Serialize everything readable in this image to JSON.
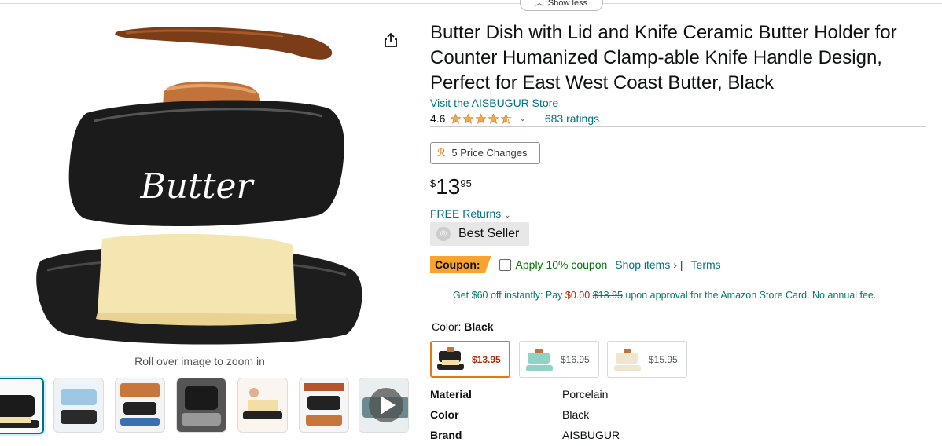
{
  "top": {
    "show_less": "Show less"
  },
  "gallery": {
    "zoom_hint": "Roll over image to zoom in",
    "logo_text": "Butter"
  },
  "product": {
    "title": "Butter Dish with Lid and Knife Ceramic Butter Holder for Counter Humanized Clamp-able Knife Handle Design, Perfect for East West Coast Butter, Black",
    "store_link": "Visit the AISBUGUR Store",
    "rating_value": "4.6",
    "rating_stars": 4.6,
    "ratings_count": "683 ratings",
    "price_changes": "5 Price Changes",
    "price_symbol": "$",
    "price_whole": "13",
    "price_fraction": "95",
    "free_returns": "FREE Returns",
    "best_seller": "Best Seller"
  },
  "coupon": {
    "tag": "Coupon:",
    "apply": "Apply 10% coupon",
    "shop_items": "Shop items ›",
    "separator": "|",
    "terms": "Terms"
  },
  "offer": {
    "part1": "Get $60 off instantly: Pay ",
    "pay_amount": "$0.00",
    "old_price": "$13.95",
    "part2": " upon approval for the Amazon Store Card. No annual fee."
  },
  "color": {
    "label": "Color: ",
    "selected": "Black",
    "options": [
      {
        "price": "$13.95",
        "swatch": "#222222"
      },
      {
        "price": "$16.95",
        "swatch": "#8fd3c7"
      },
      {
        "price": "$15.95",
        "swatch": "#efe6cf"
      }
    ]
  },
  "specs": [
    {
      "key": "Material",
      "value": "Porcelain"
    },
    {
      "key": "Color",
      "value": "Black"
    },
    {
      "key": "Brand",
      "value": "AISBUGUR"
    }
  ],
  "colors": {
    "link": "#007185",
    "price_red": "#b12704",
    "coupon_orange": "#f7a32f",
    "star": "#f3a847",
    "green": "#007600"
  }
}
